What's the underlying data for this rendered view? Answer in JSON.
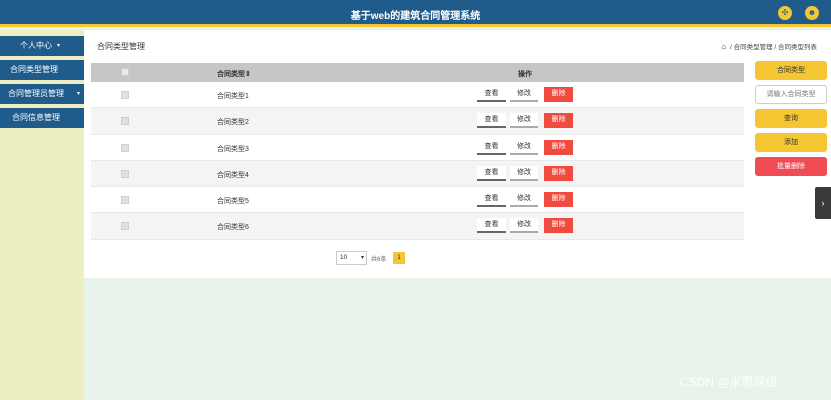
{
  "header": {
    "title": "基于web的建筑合同管理系统"
  },
  "sidebar": {
    "items": [
      {
        "label": "个人中心"
      },
      {
        "label": "合同类型管理"
      },
      {
        "label": "合同管理员管理"
      },
      {
        "label": "合同信息管理"
      }
    ]
  },
  "main": {
    "page_title": "合同类型管理",
    "breadcrumb": {
      "items": [
        "合同类型管理",
        "合同类型列表"
      ],
      "separator": "/"
    }
  },
  "table": {
    "columns": {
      "name": "合同类型",
      "sort_mark": "⇕",
      "ops": "操作"
    },
    "rows": [
      {
        "name": "合同类型1"
      },
      {
        "name": "合同类型2"
      },
      {
        "name": "合同类型3"
      },
      {
        "name": "合同类型4"
      },
      {
        "name": "合同类型5"
      },
      {
        "name": "合同类型6"
      }
    ],
    "actions": {
      "view": "查看",
      "edit": "修改",
      "delete": "删除"
    }
  },
  "pagination": {
    "page_size": "10",
    "total": "共6条",
    "current_page": "1"
  },
  "right_panel": {
    "type_label": "合同类型",
    "search_placeholder": "请输入合同类型",
    "query": "查询",
    "add": "添加",
    "batch_delete": "批量删除"
  },
  "watermark": "CSDN @米恩网络",
  "colors": {
    "header_bg": "#1f5c8b",
    "accent_yellow": "#f3c632",
    "delete_red": "#f04b3f",
    "sidebar_bg": "#eeeec3",
    "page_bg": "#e6f2ea"
  },
  "icons": {
    "header_left": "expand-icon",
    "header_right": "user-icon",
    "breadcrumb_home": "home-icon",
    "side_tab": "chevron-right-icon",
    "sidebar_arrow": "caret-down-icon"
  }
}
